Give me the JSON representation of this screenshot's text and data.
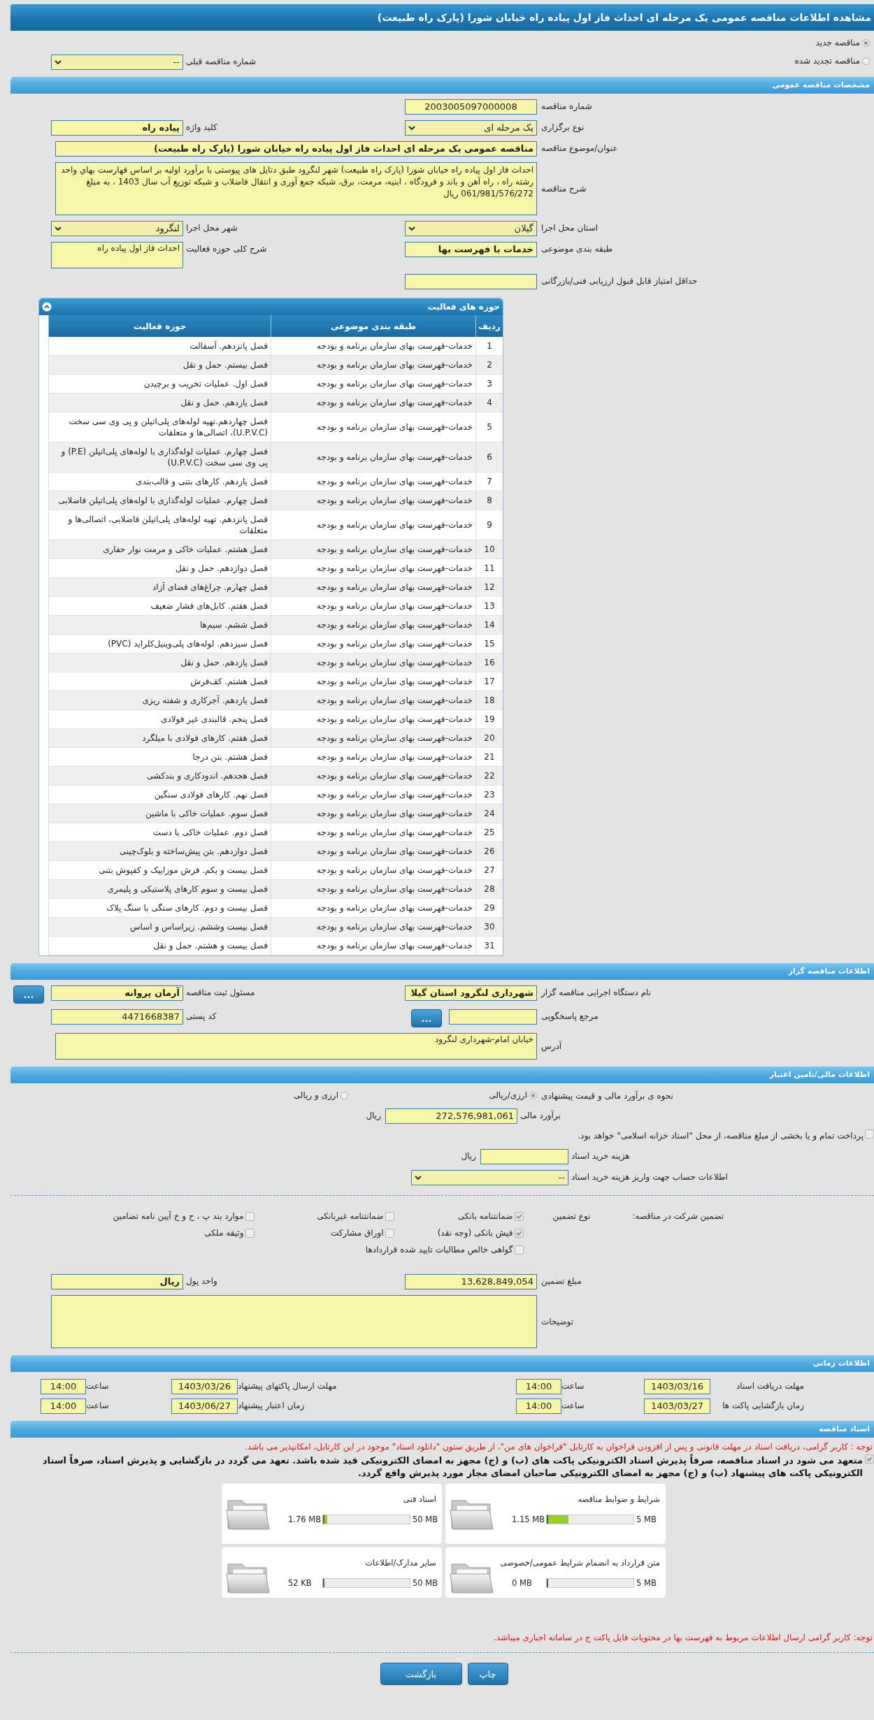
{
  "title": "مشاهده اطلاعات مناقصه عمومی یک مرحله ای احداث فاز اول پیاده راه خیابان شورا (پارک راه طبیعت)",
  "tender_kind": [
    {
      "label": "مناقصه جدید",
      "selected": true
    },
    {
      "label": "مناقصه تجدید شده",
      "selected": false
    }
  ],
  "previous_tender": {
    "label": "شماره مناقصه قبلی",
    "value": "--"
  },
  "general": {
    "heading": "مشخصات مناقصه عمومی",
    "tender_number": {
      "label": "شماره مناقصه",
      "value": "2003005097000008"
    },
    "holding_type": {
      "label": "نوع برگزاری",
      "value": "یک مرحله ای"
    },
    "keyword": {
      "label": "کلید واژه",
      "value": "پیاده راه"
    },
    "subject": {
      "label": "عنوان/موضوع مناقصه",
      "value": "مناقصه عمومی یک مرحله ای احداث فاز اول پیاده راه خیابان شورا (پارک راه طبیعت)"
    },
    "description": {
      "label": "شرح مناقصه",
      "value": "احداث فاز اول پیاده راه خیابان شورا (پارک راه طبیعت) شهر لنگرود طبق دتایل های پیوستی با برآورد اولیه بر اساس فهارست بهاي واحد رشته راه ، راه آهن و باند و فرودگاه ، ابنيه، مرمت، برق، شبکه جمع آوری و انتقال فاضلاب و شبکه توزیع آب سال 1403 ، به مبلغ 061/981/576/272 ریال"
    },
    "province": {
      "label": "استان محل اجرا",
      "value": "گیلان"
    },
    "city": {
      "label": "شهر محل اجرا",
      "value": "لنگرود"
    },
    "category": {
      "label": "طبقه بندی موضوعی",
      "value": "خدمات با فهرست بها"
    },
    "activity_summary": {
      "label": "شرح کلی حوزه فعالیت",
      "value": "احداث فاز اول پیاده راه"
    },
    "min_score": {
      "label": "حداقل امتیاز قابل قبول ارزیابی فنی/بازرگانی"
    }
  },
  "activities": {
    "heading": "حوزه های فعالیت",
    "columns": [
      "ردیف",
      "طبقه بندی موضوعی",
      "حوزه فعالیت"
    ],
    "rows": [
      [
        "1",
        "خدمات-فهرست بهای سازمان برنامه و بودجه",
        "فصل پانزدهم. آسفالت"
      ],
      [
        "2",
        "خدمات-فهرست بهای سازمان برنامه و بودجه",
        "فصل بیستم. حمل و نقل"
      ],
      [
        "3",
        "خدمات-فهرست بهای سازمان برنامه و بودجه",
        "فصل اول. عملیات تخریب و برچیدن"
      ],
      [
        "4",
        "خدمات-فهرست بهای سازمان برنامه و بودجه",
        "فصل یازدهم. حمل و نقل"
      ],
      [
        "5",
        "خدمات-فهرست بهای سازمان برنامه و بودجه",
        "فصل چهاردهم.تهیه لوله‌های پلی‌اتیلن و پی وی سی سخت (U.P.V.C)، اتصالی‌ها و متعلقات"
      ],
      [
        "6",
        "خدمات-فهرست بهای سازمان برنامه و بودجه",
        "فصل چهارم. عملیات لوله‌گذاری با لوله‌های پلی‌اتیلن (P.E) و پی وی سی سخت (U.P.V.C)"
      ],
      [
        "7",
        "خدمات-فهرست بهای سازمان برنامه و بودجه",
        "فصل یازدهم. کارهای بتنی و قالب‌بندی"
      ],
      [
        "8",
        "خدمات-فهرست بهای سازمان برنامه و بودجه",
        "فصل چهارم. عملیات لوله‌گذاری با لوله‌های پلی‌اتیلن فاضلابی"
      ],
      [
        "9",
        "خدمات-فهرست بهای سازمان برنامه و بودجه",
        "فصل پانزدهم. تهیه لوله‌های پلی‌اتیلن فاضلابی، اتصالی‌ها و متعلقات"
      ],
      [
        "10",
        "خدمات-فهرست بهای سازمان برنامه و بودجه",
        "فصل هشتم. عملیات خاکی و مرمت نوار حفاری"
      ],
      [
        "11",
        "خدمات-فهرست بهای سازمان برنامه و بودجه",
        "فصل دوازدهم. حمل و نقل"
      ],
      [
        "12",
        "خدمات-فهرست بهای سازمان برنامه و بودجه",
        "فصل چهارم. چراغ‌های فضای آزاد"
      ],
      [
        "13",
        "خدمات-فهرست بهای سازمان برنامه و بودجه",
        "فصل هفتم. کابل‌های فشار ضعیف"
      ],
      [
        "14",
        "خدمات-فهرست بهای سازمان برنامه و بودجه",
        "فصل ششم. سیم‌ها"
      ],
      [
        "15",
        "خدمات-فهرست بهای سازمان برنامه و بودجه",
        "فصل سیزدهم. لوله‌های پلی‌وینیل‌کلراید (PVC)"
      ],
      [
        "16",
        "خدمات-فهرست بهای سازمان برنامه و بودجه",
        "فصل یازدهم. حمل و نقل"
      ],
      [
        "17",
        "خدمات-فهرست بهای سازمان برنامه و بودجه",
        "فصل هشتم. کف‌فرش"
      ],
      [
        "18",
        "خدمات-فهرست بهای سازمان برنامه و بودجه",
        "فصل یازدهم. آجرکاری و شفته ریزی"
      ],
      [
        "19",
        "خدمات-فهرست بهای سازمان برنامه و بودجه",
        "فصل پنجم. قالبندی غیر فولادی"
      ],
      [
        "20",
        "خدمات-فهرست بهای سازمان برنامه و بودجه",
        "فصل هفتم. کارهای فولادی با میلگرد"
      ],
      [
        "21",
        "خدمات-فهرست بهای سازمان برنامه و بودجه",
        "فصل هشتم. بتن درجا"
      ],
      [
        "22",
        "خدمات-فهرست بهای سازمان برنامه و بودجه",
        "فصل هجدهم. اندودکاری و بندکشی"
      ],
      [
        "23",
        "خدمات-فهرست بهای سازمان برنامه و بودجه",
        "فصل نهم. کارهای فولادی سنگین"
      ],
      [
        "24",
        "خدمات-فهرست بهای سازمان برنامه و بودجه",
        "فصل سوم. عملیات خاکی با ماشین"
      ],
      [
        "25",
        "خدمات-فهرست بهای سازمان برنامه و بودجه",
        "فصل دوم. عملیات خاکی با دست"
      ],
      [
        "26",
        "خدمات-فهرست بهای سازمان برنامه و بودجه",
        "فصل دوازدهم. بتن پیش‌ساخته و بلوک‌چینی"
      ],
      [
        "27",
        "خدمات-فهرست بهای سازمان برنامه و بودجه",
        "فصل بیست و یکم. فرش موزاییک و کفپوش بتنی"
      ],
      [
        "28",
        "خدمات-فهرست بهای سازمان برنامه و بودجه",
        "فصل بیست و سوم کارهای پلاستیکی و پلیمری"
      ],
      [
        "29",
        "خدمات-فهرست بهای سازمان برنامه و بودجه",
        "فصل بیست و دوم. کارهای سنگی با سنگ پلاک"
      ],
      [
        "30",
        "خدمات-فهرست بهای سازمان برنامه و بودجه",
        "فصل بیست وششم. زیراساس و اساس"
      ],
      [
        "31",
        "خدمات-فهرست بهای سازمان برنامه و بودجه",
        "فصل بیست و هشتم. حمل و نقل"
      ]
    ]
  },
  "organizer": {
    "heading": "اطلاعات مناقصه گزار",
    "org_name": {
      "label": "نام دستگاه اجرایی مناقصه گزار",
      "value": "شهرداری لنگرود استان گیلا"
    },
    "registrar": {
      "label": "مسئول ثبت مناقصه",
      "value": "آرمان پروانه",
      "button": "..."
    },
    "responder": {
      "label": "مرجع پاسخگویی",
      "button": "..."
    },
    "postal_code": {
      "label": "کد پستی",
      "value": "4471668387"
    },
    "address": {
      "label": "آدرس",
      "value": "خیابان امام-شهرداری لنگرود"
    }
  },
  "finance": {
    "heading": "اطلاعات مالی/تامین اعتبار",
    "estimate_method": {
      "label": "نحوه ی برآورد مالی و قیمت پیشنهادی",
      "options": [
        {
          "label": "ارزی/ریالی",
          "selected": true
        },
        {
          "label": "ارزی و ریالی",
          "selected": false
        }
      ]
    },
    "estimate": {
      "label": "برآورد مالی",
      "value": "272,576,981,061",
      "unit": "ریال"
    },
    "treasury": {
      "label": "پرداخت تمام و یا بخشی از مبلغ مناقصه، از محل \"اسناد خزانه اسلامی\" خواهد بود.",
      "checked": false
    },
    "doc_fee": {
      "label": "هزینه خرید اسناد",
      "unit": "ریال"
    },
    "fee_account": {
      "label": "اطلاعات حساب جهت واریز هزینه خرید اسناد",
      "value": "--"
    },
    "guarantee": {
      "label": "تضمین شرکت در مناقصه:",
      "type_label": "نوع تضمین",
      "options": [
        {
          "label": "ضمانتنامه بانکی",
          "checked": true
        },
        {
          "label": "ضمانتنامه غیربانکی",
          "checked": false
        },
        {
          "label": "موارد بند پ ، ح و خ آیین نامه تضامین",
          "checked": false
        },
        {
          "label": "فیش بانکی (وجه نقد)",
          "checked": true
        },
        {
          "label": "اوراق مشارکت",
          "checked": false
        },
        {
          "label": "وثیقه ملکی",
          "checked": false
        },
        {
          "label": "گواهی خالص مطالبات تایید شده قراردادها",
          "checked": false
        }
      ]
    },
    "guarantee_amount": {
      "label": "مبلغ تضمین",
      "value": "13,628,849,054"
    },
    "currency": {
      "label": "واحد پول",
      "value": "ریال"
    },
    "notes": {
      "label": "توضیحات"
    }
  },
  "timing": {
    "heading": "اطلاعات زمانی",
    "entries": [
      {
        "label": "مهلت دریافت اسناد",
        "date": "1403/03/16",
        "time_label": "ساعت",
        "time": "14:00"
      },
      {
        "label": "مهلت ارسال پاکتهای پیشنهاد",
        "date": "1403/03/26",
        "time_label": "ساعت",
        "time": "14:00"
      },
      {
        "label": "زمان بازگشایی پاکت ها",
        "date": "1403/03/27",
        "time_label": "ساعت",
        "time": "14:00"
      },
      {
        "label": "زمان اعتبار پیشنهاد",
        "date": "1403/06/27",
        "time_label": "ساعت",
        "time": "14:00"
      }
    ]
  },
  "documents": {
    "heading": "اسناد مناقصه",
    "notice": "توجه : کاربر گرامی، دریافت اسناد در مهلت قانونی و پس از افزودن فراخوان به کارتابل \"فراخوان های من\"، از طریق ستون \"دانلود اسناد\" موجود در این کارتابل، امکانپذیر می باشد.",
    "commitment": {
      "text": "متعهد می شود در اسناد مناقصه، صرفاً پذیرش اسناد الکترونیکی پاکت های (ب) و (ج) مجهز به امضای الکترونیکی قید شده باشد. تعهد می گردد در بازگشایی و پذیرش اسناد، صرفاً اسناد الکترونیکی پاکت های پیشنهاد (ب) و (ج) مجهز به امضای الکترونیکی صاحبان امضای مجاز مورد پذیرش واقع گردد.",
      "checked": true
    },
    "files": [
      {
        "title": "شرایط و ضوابط مناقصه",
        "size": "1.15 MB",
        "max": "5 MB",
        "level": 0.23
      },
      {
        "title": "اسناد فنی",
        "size": "1.76 MB",
        "max": "50 MB",
        "level": 0.035
      },
      {
        "title": "متن قرارداد به انضمام شرایط عمومی/خصوصی",
        "size": "0 MB",
        "max": "5 MB",
        "level": 0
      },
      {
        "title": "سایر مدارک/اطلاعات",
        "size": "52 KB",
        "max": "50 MB",
        "level": 0.001
      }
    ],
    "footer_notice": "توجه: کاربر گرامی ارسال اطلاعات مربوط به فهرست بها در محتویات فایل پاکت ج در سامانه اجباری میباشد."
  },
  "buttons": [
    {
      "label": "چاپ"
    },
    {
      "label": "بازگشت"
    }
  ]
}
